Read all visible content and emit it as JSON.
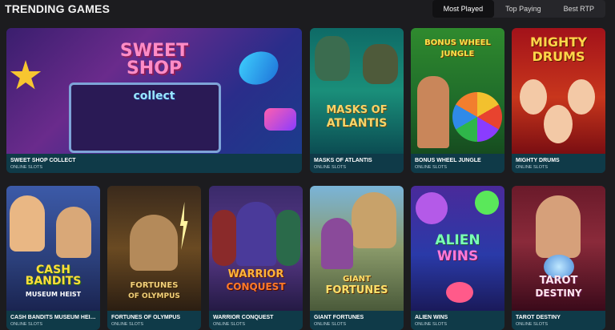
{
  "header": {
    "title": "TRENDING GAMES",
    "tabs": [
      "Most Played",
      "Top Paying",
      "Best RTP"
    ]
  },
  "category_label": "ONLINE SLOTS",
  "games": [
    {
      "title": "SWEET SHOP COLLECT",
      "subtitle": "ONLINE SLOTS",
      "logo": "SWEET SHOP",
      "logo2": "collect"
    },
    {
      "title": "MASKS OF ATLANTIS",
      "subtitle": "ONLINE SLOTS",
      "logo": "MASKS OF",
      "logo2": "ATLANTIS"
    },
    {
      "title": "BONUS WHEEL JUNGLE",
      "subtitle": "ONLINE SLOTS",
      "logo": "BONUS WHEEL",
      "logo2": "JUNGLE"
    },
    {
      "title": "MIGHTY DRUMS",
      "subtitle": "ONLINE SLOTS",
      "logo": "MIGHTY",
      "logo2": "DRUMS"
    },
    {
      "title": "CASH BANDITS MUSEUM HEIST",
      "subtitle": "ONLINE SLOTS",
      "logo": "CASH BANDITS",
      "logo2": "MUSEUM HEIST"
    },
    {
      "title": "FORTUNES OF OLYMPUS",
      "subtitle": "ONLINE SLOTS",
      "logo": "FORTUNES",
      "logo2": "OF OLYMPUS"
    },
    {
      "title": "WARRIOR CONQUEST",
      "subtitle": "ONLINE SLOTS",
      "logo": "WARRIOR",
      "logo2": "CONQUEST"
    },
    {
      "title": "GIANT FORTUNES",
      "subtitle": "ONLINE SLOTS",
      "logo": "GIANT",
      "logo2": "FORTUNES"
    },
    {
      "title": "ALIEN WINS",
      "subtitle": "ONLINE SLOTS",
      "logo": "ALIEN",
      "logo2": "WINS"
    },
    {
      "title": "TAROT DESTINY",
      "subtitle": "ONLINE SLOTS",
      "logo": "TAROT",
      "logo2": "DESTINY"
    }
  ],
  "colors": {
    "page_bg": "#1c1c1f",
    "caption_bg": "#0f3a48",
    "tab_active_bg": "#111113"
  }
}
